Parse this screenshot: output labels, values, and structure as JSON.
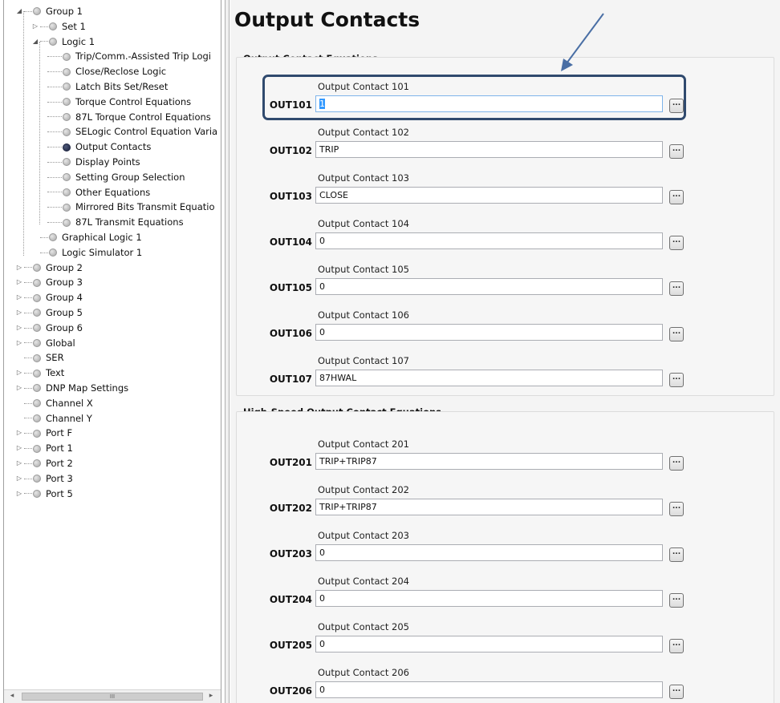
{
  "tree": {
    "items": [
      {
        "label": "Group 1",
        "level": 0,
        "expander": "expanded",
        "selected": false
      },
      {
        "label": "Set 1",
        "level": 1,
        "expander": "collapsed",
        "selected": false
      },
      {
        "label": "Logic 1",
        "level": 1,
        "expander": "expanded",
        "selected": false
      },
      {
        "label": "Trip/Comm.-Assisted Trip Logi",
        "level": 2,
        "expander": "none",
        "selected": false
      },
      {
        "label": "Close/Reclose Logic",
        "level": 2,
        "expander": "none",
        "selected": false
      },
      {
        "label": "Latch Bits Set/Reset",
        "level": 2,
        "expander": "none",
        "selected": false
      },
      {
        "label": "Torque Control Equations",
        "level": 2,
        "expander": "none",
        "selected": false
      },
      {
        "label": "87L Torque Control Equations",
        "level": 2,
        "expander": "none",
        "selected": false
      },
      {
        "label": "SELogic Control Equation Varia",
        "level": 2,
        "expander": "none",
        "selected": false
      },
      {
        "label": "Output Contacts",
        "level": 2,
        "expander": "none",
        "selected": true
      },
      {
        "label": "Display Points",
        "level": 2,
        "expander": "none",
        "selected": false
      },
      {
        "label": "Setting Group Selection",
        "level": 2,
        "expander": "none",
        "selected": false
      },
      {
        "label": "Other Equations",
        "level": 2,
        "expander": "none",
        "selected": false
      },
      {
        "label": "Mirrored Bits Transmit Equatio",
        "level": 2,
        "expander": "none",
        "selected": false
      },
      {
        "label": "87L Transmit Equations",
        "level": 2,
        "expander": "none",
        "selected": false
      },
      {
        "label": "Graphical Logic 1",
        "level": 1,
        "expander": "none",
        "selected": false
      },
      {
        "label": "Logic Simulator 1",
        "level": 1,
        "expander": "none",
        "selected": false
      },
      {
        "label": "Group 2",
        "level": 0,
        "expander": "collapsed",
        "selected": false
      },
      {
        "label": "Group 3",
        "level": 0,
        "expander": "collapsed",
        "selected": false
      },
      {
        "label": "Group 4",
        "level": 0,
        "expander": "collapsed",
        "selected": false
      },
      {
        "label": "Group 5",
        "level": 0,
        "expander": "collapsed",
        "selected": false
      },
      {
        "label": "Group 6",
        "level": 0,
        "expander": "collapsed",
        "selected": false
      },
      {
        "label": "Global",
        "level": 0,
        "expander": "collapsed",
        "selected": false
      },
      {
        "label": "SER",
        "level": 0,
        "expander": "none",
        "selected": false
      },
      {
        "label": "Text",
        "level": 0,
        "expander": "collapsed",
        "selected": false
      },
      {
        "label": "DNP Map Settings",
        "level": 0,
        "expander": "collapsed",
        "selected": false
      },
      {
        "label": "Channel X",
        "level": 0,
        "expander": "none",
        "selected": false
      },
      {
        "label": "Channel Y",
        "level": 0,
        "expander": "none",
        "selected": false
      },
      {
        "label": "Port F",
        "level": 0,
        "expander": "collapsed",
        "selected": false
      },
      {
        "label": "Port 1",
        "level": 0,
        "expander": "collapsed",
        "selected": false
      },
      {
        "label": "Port 2",
        "level": 0,
        "expander": "collapsed",
        "selected": false
      },
      {
        "label": "Port 3",
        "level": 0,
        "expander": "collapsed",
        "selected": false
      },
      {
        "label": "Port 5",
        "level": 0,
        "expander": "collapsed",
        "selected": false
      }
    ],
    "scrollbar": {
      "left_arrow": "◂",
      "right_arrow": "▸",
      "thumb_grip": "III"
    }
  },
  "main": {
    "title": "Output Contacts",
    "sections": [
      {
        "title": "Output Contact Equations",
        "fields": [
          {
            "name": "OUT101",
            "caption": "Output Contact 101",
            "value": "1",
            "active": true
          },
          {
            "name": "OUT102",
            "caption": "Output Contact 102",
            "value": "TRIP",
            "active": false
          },
          {
            "name": "OUT103",
            "caption": "Output Contact 103",
            "value": "CLOSE",
            "active": false
          },
          {
            "name": "OUT104",
            "caption": "Output Contact 104",
            "value": "0",
            "active": false
          },
          {
            "name": "OUT105",
            "caption": "Output Contact 105",
            "value": "0",
            "active": false
          },
          {
            "name": "OUT106",
            "caption": "Output Contact 106",
            "value": "0",
            "active": false
          },
          {
            "name": "OUT107",
            "caption": "Output Contact 107",
            "value": "87HWAL",
            "active": false
          }
        ]
      },
      {
        "title": "High-Speed Output Contact Equations",
        "fields": [
          {
            "name": "OUT201",
            "caption": "Output Contact 201",
            "value": "TRIP+TRIP87",
            "active": false
          },
          {
            "name": "OUT202",
            "caption": "Output Contact 202",
            "value": "TRIP+TRIP87",
            "active": false
          },
          {
            "name": "OUT203",
            "caption": "Output Contact 203",
            "value": "0",
            "active": false
          },
          {
            "name": "OUT204",
            "caption": "Output Contact 204",
            "value": "0",
            "active": false
          },
          {
            "name": "OUT205",
            "caption": "Output Contact 205",
            "value": "0",
            "active": false
          },
          {
            "name": "OUT206",
            "caption": "Output Contact 206",
            "value": "0",
            "active": false
          }
        ]
      }
    ],
    "ellipsis_label": "..."
  },
  "annotation": {
    "highlight_color": "#304a6e",
    "arrow_color": "#4a6fa5"
  },
  "colors": {
    "selection": "#3399ff",
    "selected_node": "#1d2440"
  }
}
